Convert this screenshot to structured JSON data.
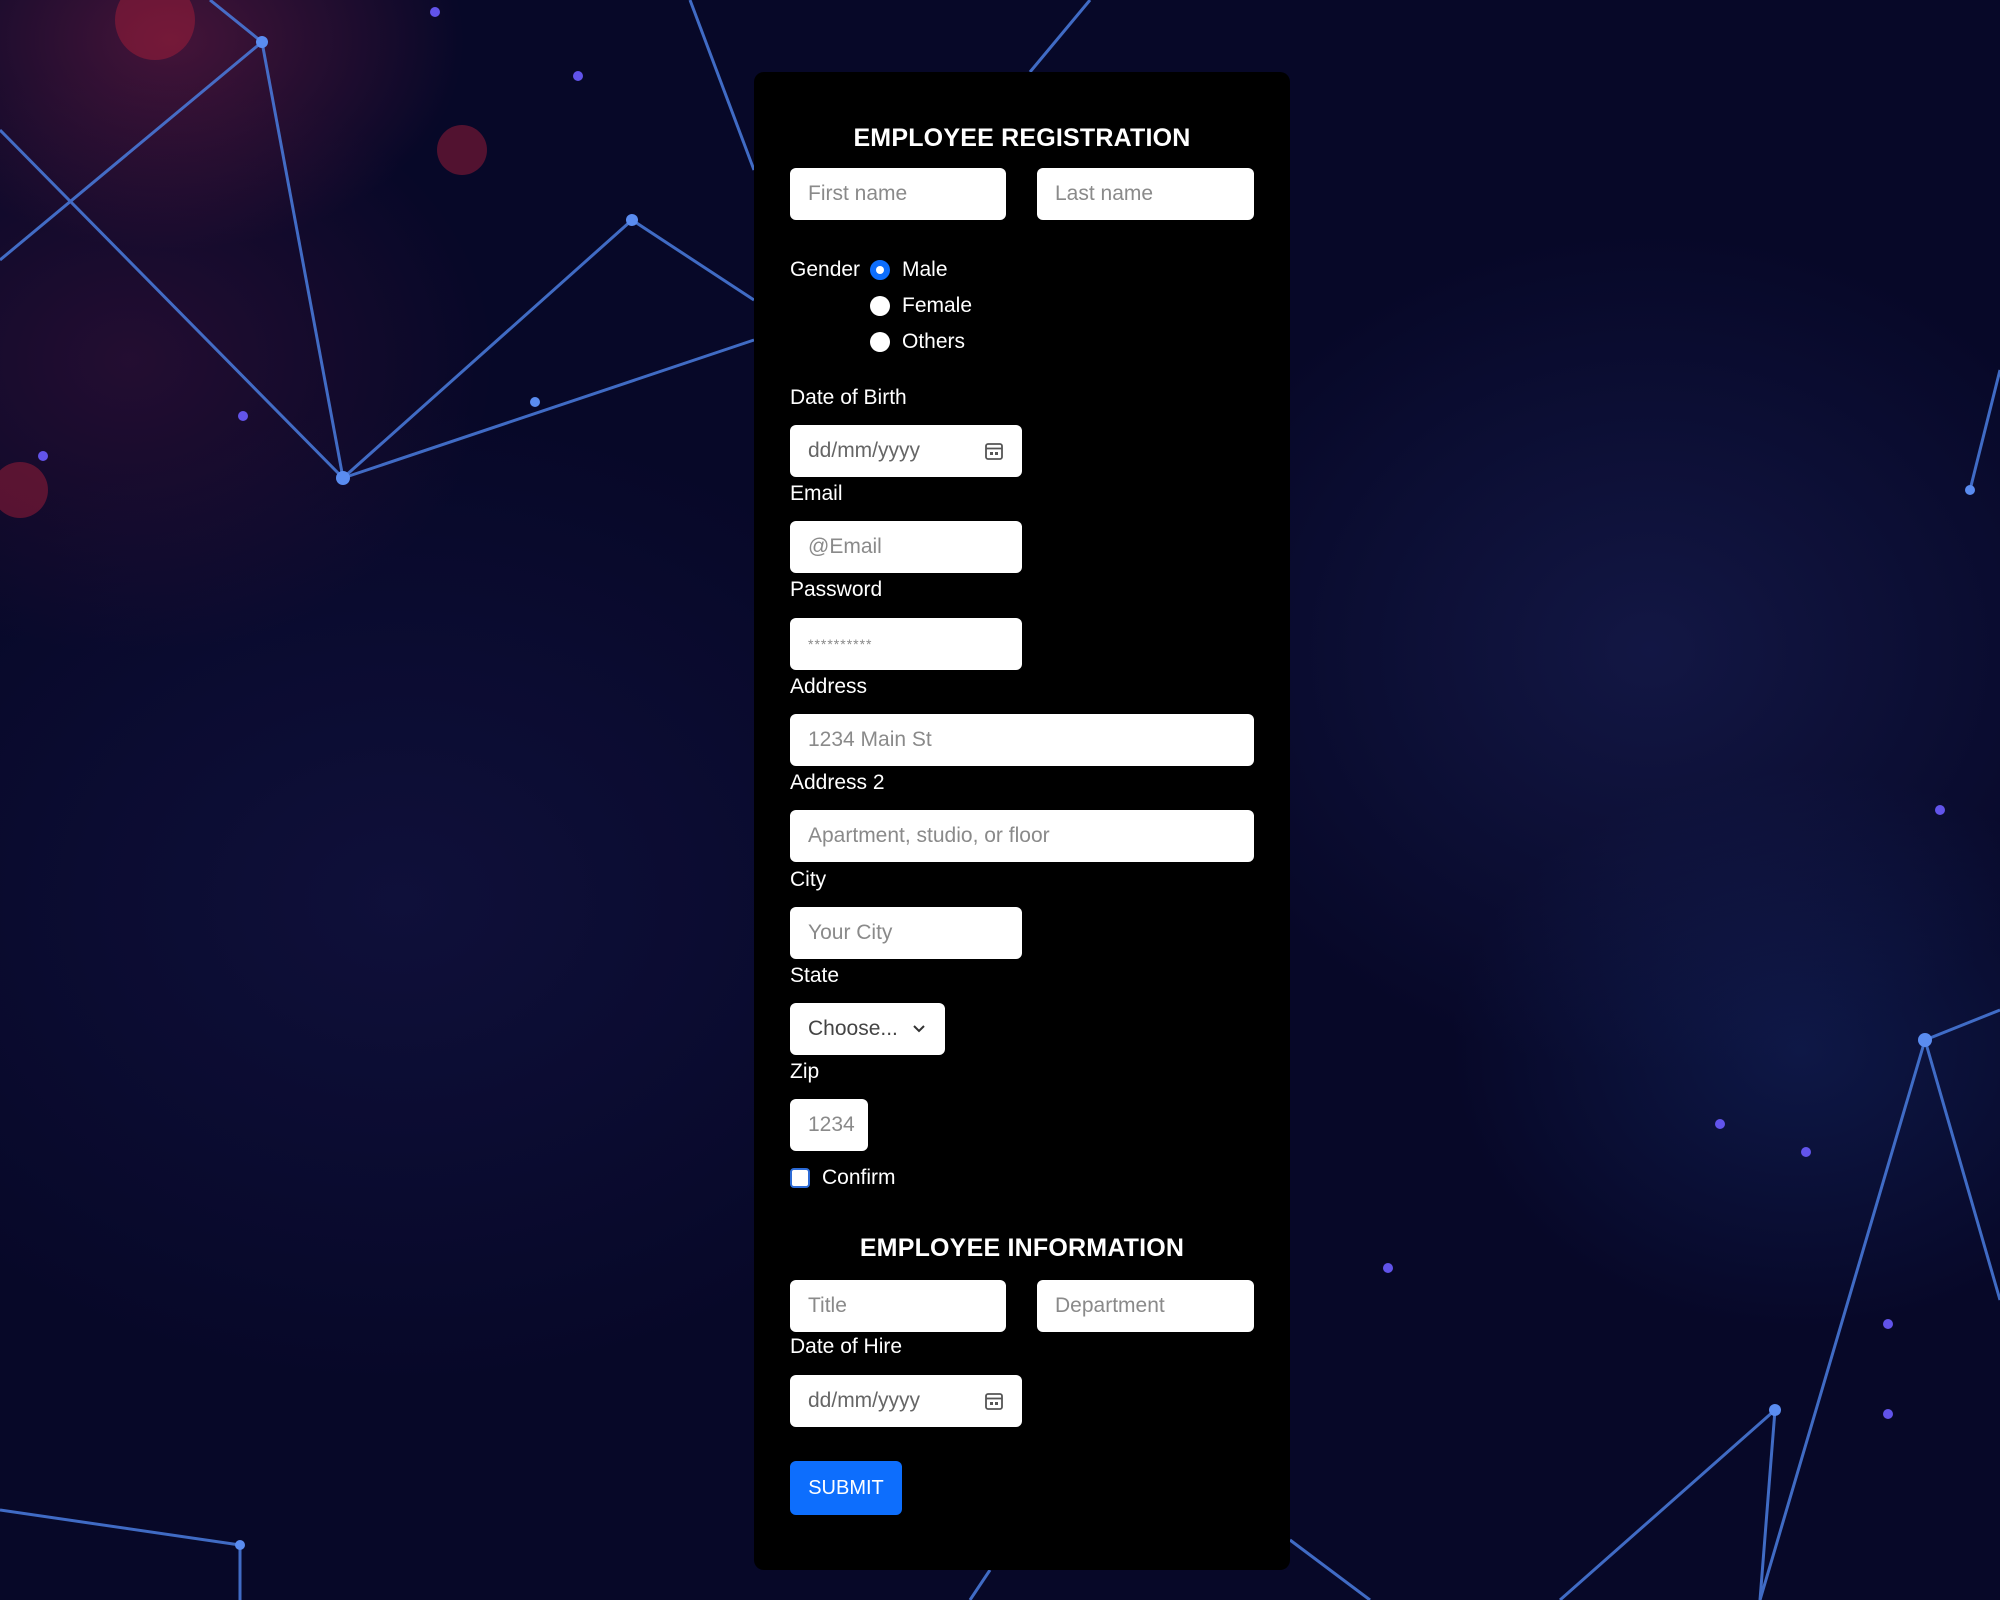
{
  "registration": {
    "heading": "EMPLOYEE REGISTRATION",
    "first_name_placeholder": "First name",
    "last_name_placeholder": "Last name",
    "gender": {
      "label": "Gender",
      "options": [
        "Male",
        "Female",
        "Others"
      ],
      "selected": "Male"
    },
    "dob_label": "Date of Birth",
    "dob_placeholder": "dd/mm/yyyy",
    "email_label": "Email",
    "email_placeholder": "@Email",
    "password_label": "Password",
    "password_placeholder": "**********",
    "address_label": "Address",
    "address_placeholder": "1234 Main St",
    "address2_label": "Address 2",
    "address2_placeholder": "Apartment, studio, or floor",
    "city_label": "City",
    "city_placeholder": "Your City",
    "state_label": "State",
    "state_selected": "Choose...",
    "zip_label": "Zip",
    "zip_placeholder": "1234",
    "confirm_label": "Confirm",
    "confirm_checked": false
  },
  "information": {
    "heading": "EMPLOYEE INFORMATION",
    "title_placeholder": "Title",
    "department_placeholder": "Department",
    "hire_label": "Date of Hire",
    "hire_placeholder": "dd/mm/yyyy",
    "submit_label": "SUBMIT"
  },
  "colors": {
    "card_background": "#000000",
    "accent": "#0d6efd",
    "page_background": "#070828"
  }
}
